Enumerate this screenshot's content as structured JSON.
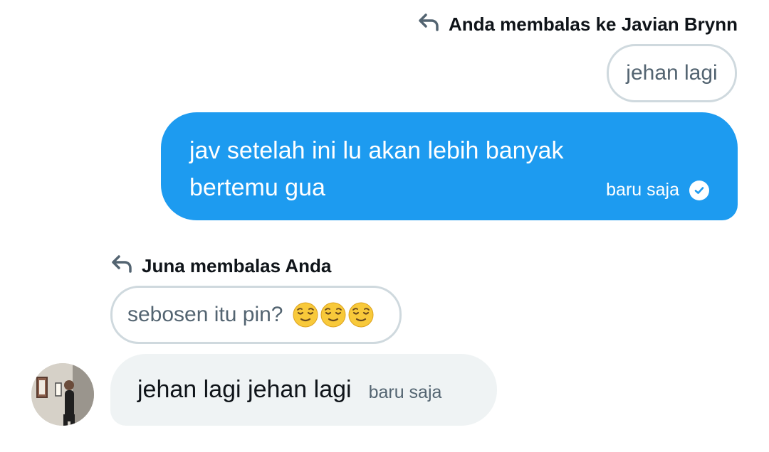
{
  "thread": {
    "outgoing_reply": {
      "label": "Anda membalas ke Javian Brynn",
      "quoted_text": "jehan lagi"
    },
    "sent_message": {
      "text": "jav setelah ini lu akan lebih banyak bertemu gua",
      "time": "baru saja",
      "status_icon": "check-circle-icon"
    },
    "incoming_reply": {
      "label": "Juna membalas Anda",
      "quoted_text": "sebosen itu pin?",
      "emojis": [
        "relieved-face-emoji",
        "relieved-face-emoji",
        "relieved-face-emoji"
      ]
    },
    "received_message": {
      "text": "jehan lagi jehan lagi",
      "time": "baru saja",
      "avatar": "user-avatar"
    }
  },
  "colors": {
    "sent_bubble": "#1d9bf0",
    "received_bubble": "#eff3f4",
    "muted_text": "#536471",
    "primary_text": "#0f1419",
    "quote_border": "#cfd9de"
  }
}
